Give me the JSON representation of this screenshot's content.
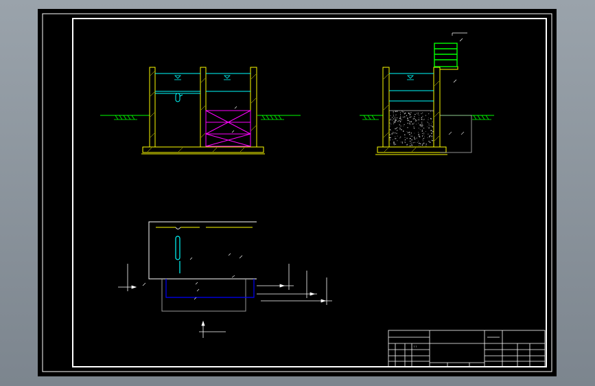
{
  "colors": {
    "workspace_background": "#8a939c",
    "paper": "#000000",
    "frame": "#ffffff",
    "wall": "#ffff00",
    "water": "#00ffff",
    "ground": "#00ff00",
    "filter_packing": "#ff00ff",
    "pipe": "#0000ff",
    "dimension": "#ffffff"
  },
  "views": [
    {
      "name": "section-view-two-chamber-tank"
    },
    {
      "name": "section-view-filter-tank"
    },
    {
      "name": "plan-view"
    }
  ],
  "title_block": {
    "rows": 6,
    "columns": 6,
    "visible_text": ""
  }
}
